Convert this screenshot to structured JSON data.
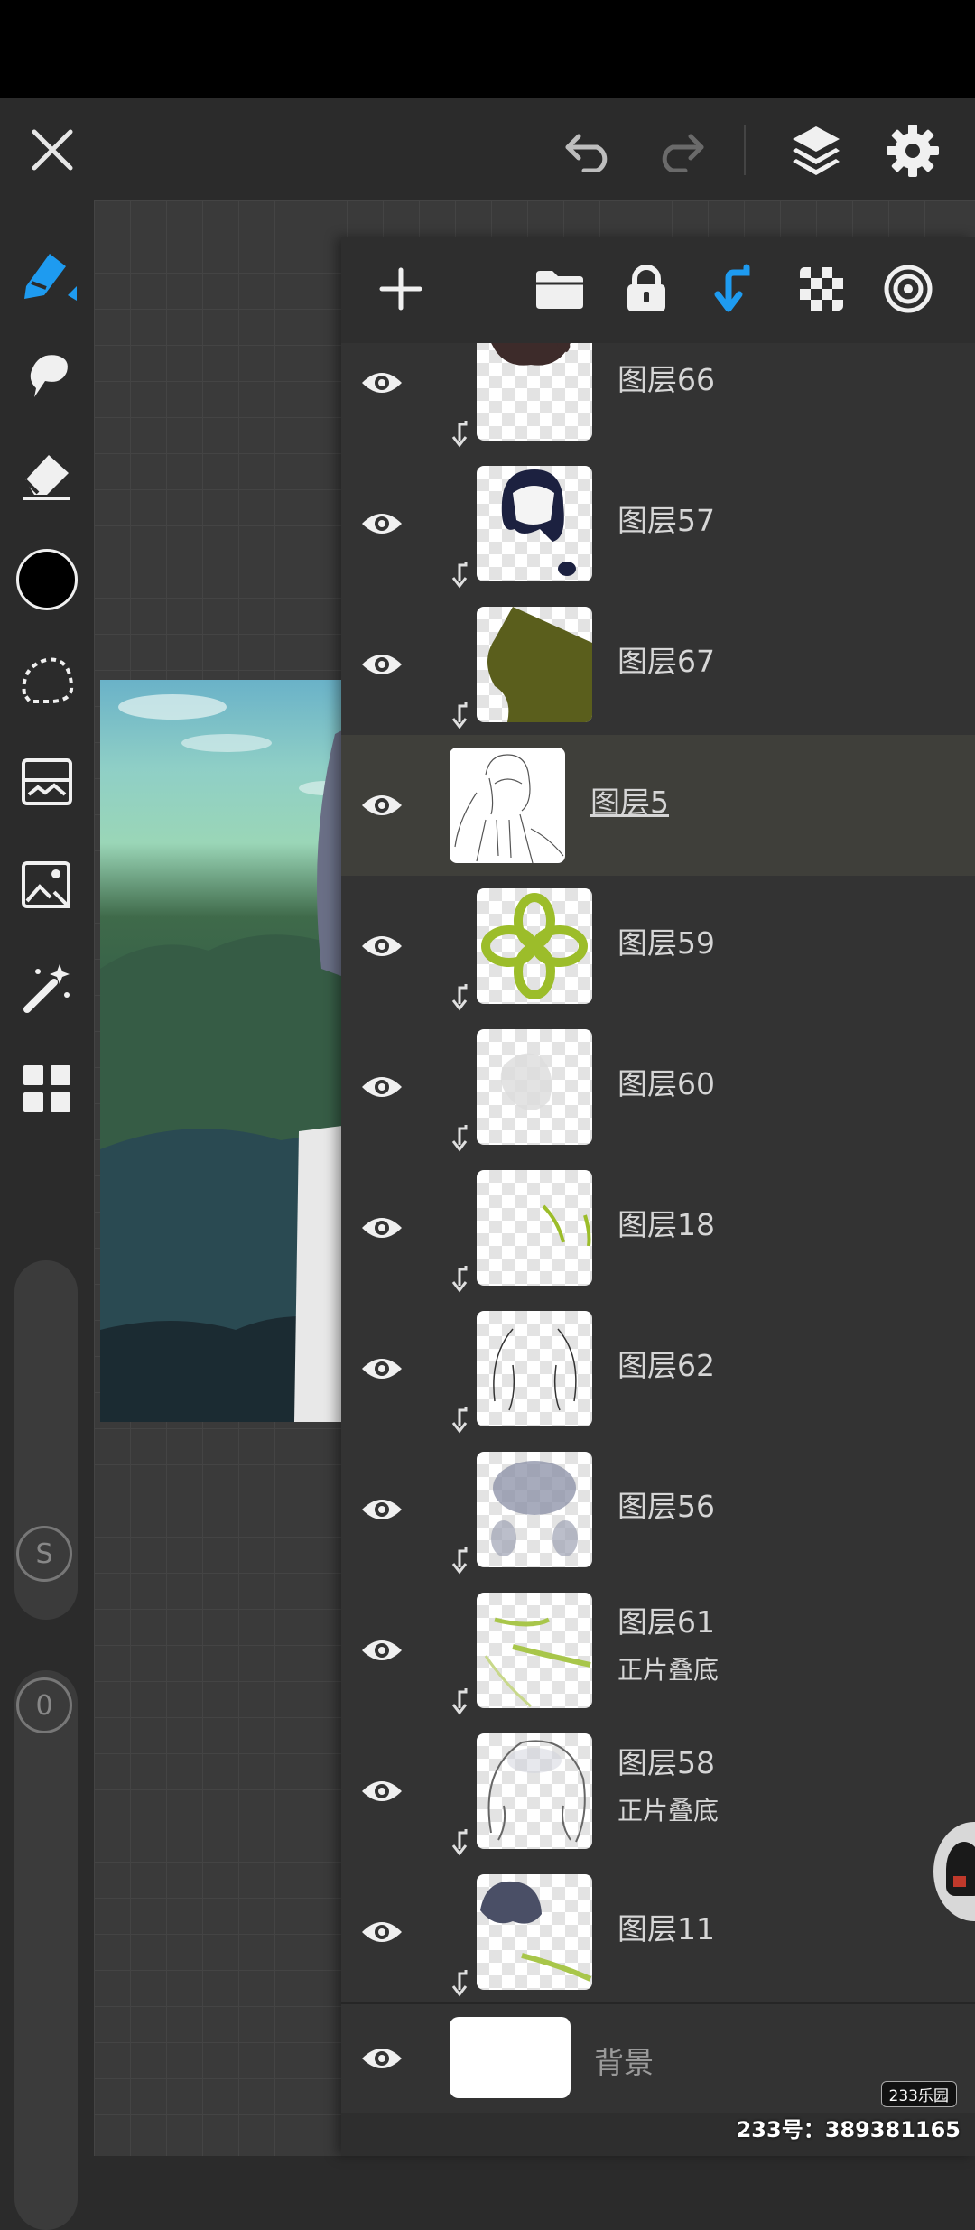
{
  "layers_panel": {
    "layers": [
      {
        "name": "图层66",
        "sub": "",
        "clipped": true,
        "visible": true
      },
      {
        "name": "图层57",
        "sub": "",
        "clipped": true,
        "visible": true
      },
      {
        "name": "图层67",
        "sub": "",
        "clipped": true,
        "visible": true
      },
      {
        "name": "图层5",
        "sub": "",
        "clipped": false,
        "visible": true,
        "selected": true
      },
      {
        "name": "图层59",
        "sub": "",
        "clipped": true,
        "visible": true
      },
      {
        "name": "图层60",
        "sub": "",
        "clipped": true,
        "visible": true
      },
      {
        "name": "图层18",
        "sub": "",
        "clipped": true,
        "visible": true
      },
      {
        "name": "图层62",
        "sub": "",
        "clipped": true,
        "visible": true
      },
      {
        "name": "图层56",
        "sub": "",
        "clipped": true,
        "visible": true
      },
      {
        "name": "图层61",
        "sub": "正片叠底",
        "clipped": true,
        "visible": true
      },
      {
        "name": "图层58",
        "sub": "正片叠底",
        "clipped": true,
        "visible": true
      },
      {
        "name": "图层11",
        "sub": "",
        "clipped": true,
        "visible": true
      }
    ],
    "background_layer": {
      "name": "背景"
    }
  },
  "brush_size_label": "S",
  "opacity_label": "0",
  "watermark": {
    "badge": "233乐园",
    "text": "233号：389381165"
  },
  "colors": {
    "accent": "#1e9bf0",
    "current_color": "#000000",
    "panel_bg": "#2e2e2e"
  }
}
